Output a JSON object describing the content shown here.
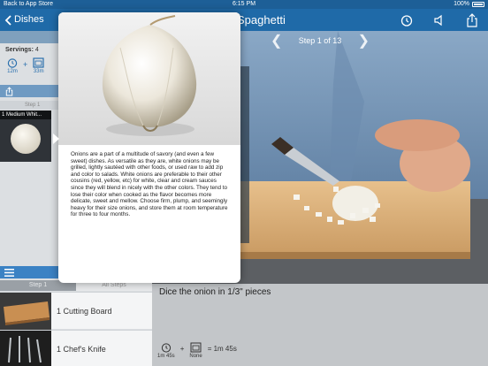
{
  "statusbar": {
    "back_label": "Back to App Store",
    "time": "6:15 PM",
    "battery": "100%"
  },
  "navbar": {
    "back_label": "Dishes",
    "title": "Spaghetti"
  },
  "sidebar": {
    "header": "Dis",
    "servings_label": "Servings:",
    "servings_value": "4",
    "prep_time": "12m",
    "cook_time": "33m",
    "step_label": "Step 1",
    "ingredient_caption": "1 Medium Whit...",
    "tabs": [
      {
        "label": "Step 1",
        "active": true
      },
      {
        "label": "All Steps",
        "active": false
      }
    ],
    "equipment": [
      {
        "label": "1 Cutting Board"
      },
      {
        "label": "1 Chef's Knife"
      }
    ]
  },
  "main": {
    "step_indicator": "Step 1 of 13",
    "instruction": "Dice the onion in 1/3\" pieces",
    "timer_prep": "1m 45s",
    "timer_cook": "None",
    "timer_total": "= 1m 45s"
  },
  "popover": {
    "description": "Onions are a part of a multitude of savory (and even a few sweet) dishes. As versatile as they are, white onions may be grilled, lightly sautéed with other foods, or used raw to add zip and color to salads. White onions are preferable to their other cousins (red, yellow, etc) for white, clear and cream sauces since they will blend in nicely with the other colors. They tend to lose their color when cooked as the flavor becomes more delicate, sweet and mellow. Choose firm, plump, and seemingly heavy for their size onions, and store them at room temperature for three to four months."
  },
  "colors": {
    "nav_blue": "#1f6aa8",
    "accent_blue": "#3b82c4",
    "sidebar_bg": "#dcdfe2"
  }
}
